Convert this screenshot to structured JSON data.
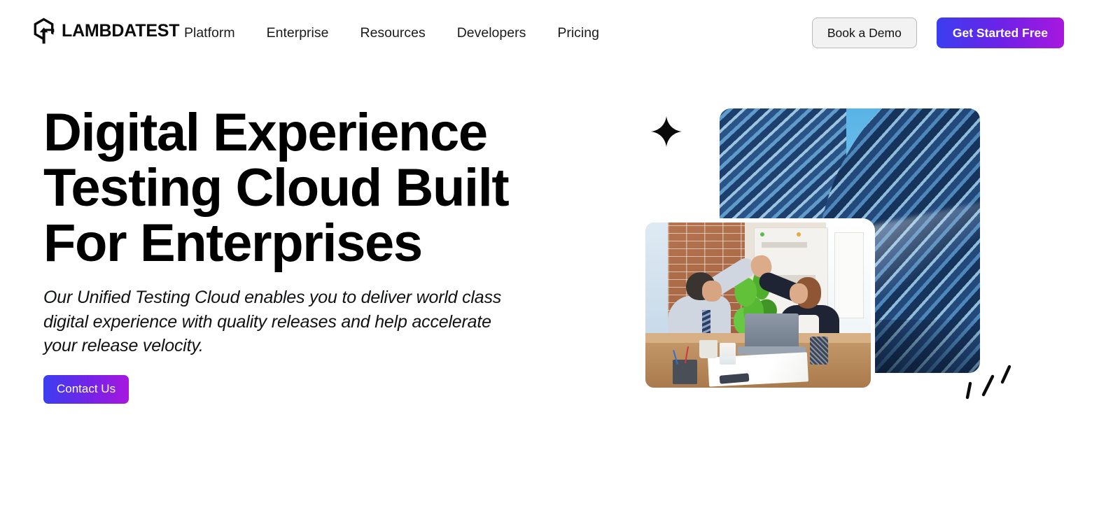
{
  "header": {
    "brand": {
      "name": "LAMBDATEST",
      "logo_icon": "lambdatest-hexagon-arrow-logo"
    },
    "nav": [
      {
        "label": "Platform"
      },
      {
        "label": "Enterprise"
      },
      {
        "label": "Resources"
      },
      {
        "label": "Developers"
      },
      {
        "label": "Pricing"
      }
    ],
    "actions": {
      "demo_label": "Book a Demo",
      "start_label": "Get Started Free"
    }
  },
  "hero": {
    "title": "Digital Experience Testing Cloud Built For Enterprises",
    "subtitle": "Our Unified Testing Cloud enables you to deliver world class digital experience with quality releases and help accelerate your release velocity.",
    "cta_label": "Contact Us",
    "media": {
      "building_photo_alt": "Modern curved skyscraper with blue diagonal stripes against a bright sky",
      "office_photo_alt": "Two business colleagues high-fiving across a desk with a laptop in a brick-walled office",
      "sparkle_icon": "four-point-star-sparkle-icon",
      "rays_icon": "radiating-lines-sparkle-icon"
    }
  },
  "colors": {
    "gradient_start": "#3b3ef0",
    "gradient_mid": "#7423e6",
    "gradient_end": "#a817de",
    "text_primary": "#000000",
    "demo_button_bg": "#f2f2f2",
    "demo_button_border": "#b9b9b9",
    "page_bg": "#ffffff"
  }
}
